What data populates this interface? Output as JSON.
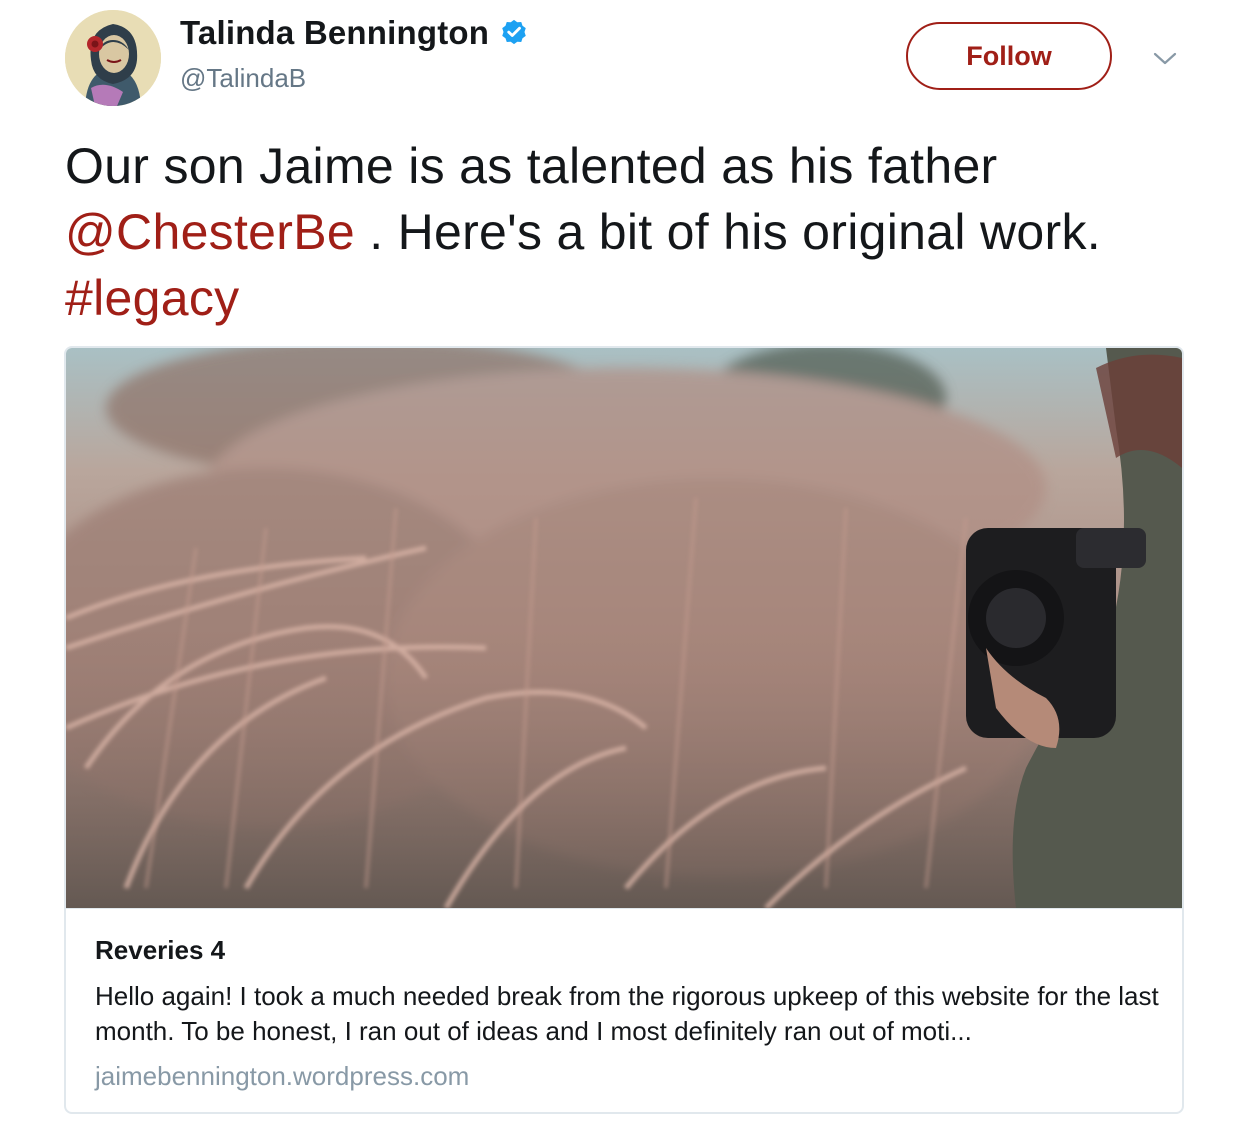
{
  "header": {
    "display_name": "Talinda Bennington",
    "handle": "@TalindaB",
    "verified": true,
    "follow_label": "Follow",
    "more_icon": "chevron-down-icon"
  },
  "tweet": {
    "text_part1": "Our son Jaime is as talented as his father ",
    "mention": "@ChesterBe",
    "text_part2": " . Here's a bit of his original work. ",
    "hashtag": "#legacy"
  },
  "card": {
    "image_icon": "photo-thumbnail",
    "title": "Reveries 4",
    "description": "Hello again! I took a much needed break from the rigorous upkeep of this website for the last month. To be honest, I ran out of ideas and I most definitely ran out of moti...",
    "url": "jaimebennington.wordpress.com"
  },
  "colors": {
    "accent": "#a01f17",
    "text": "#14171a",
    "secondary": "#657786",
    "verified": "#1da1f2",
    "border": "#e1e8ed"
  }
}
